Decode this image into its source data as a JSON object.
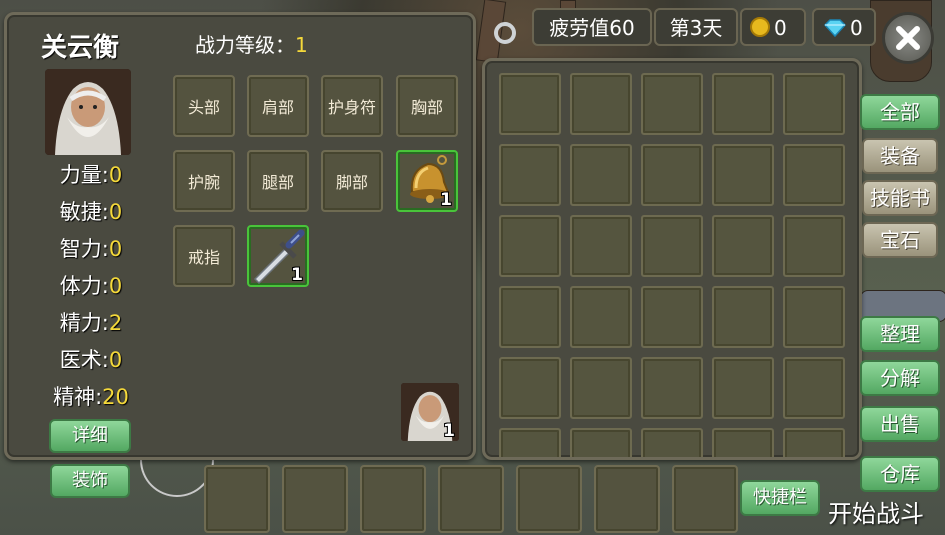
{
  "character": {
    "name": "关云衡",
    "power_label": "战力等级：",
    "power_value": "1"
  },
  "stats": [
    {
      "label": "力量:",
      "value": "0"
    },
    {
      "label": "敏捷:",
      "value": "0"
    },
    {
      "label": "智力:",
      "value": "0"
    },
    {
      "label": "体力:",
      "value": "0"
    },
    {
      "label": "精力:",
      "value": "2"
    },
    {
      "label": "医术:",
      "value": "0"
    },
    {
      "label": "精神:",
      "value": "20"
    }
  ],
  "buttons": {
    "detail": "详细",
    "decoration": "装饰",
    "sort": "整理",
    "decompose": "分解",
    "sell": "出售",
    "warehouse": "仓库",
    "quickbar": "快捷栏",
    "start_battle": "开始战斗"
  },
  "equip_slots": {
    "head": "头部",
    "shoulder": "肩部",
    "amulet": "护身符",
    "chest": "胸部",
    "wrist": "护腕",
    "legs": "腿部",
    "feet": "脚部",
    "ring": "戒指"
  },
  "equipped": {
    "bell_qty": "1",
    "sword_qty": "1",
    "portrait_qty": "1"
  },
  "topbar": {
    "fatigue": "疲劳值60",
    "day": "第3天",
    "gold": "0",
    "diamond": "0"
  },
  "tabs": [
    "全部",
    "装备",
    "技能书",
    "宝石"
  ],
  "colors": {
    "accent_green": "#53a862",
    "value_yellow": "#f5d93a",
    "highlight_border": "#49c43a"
  }
}
